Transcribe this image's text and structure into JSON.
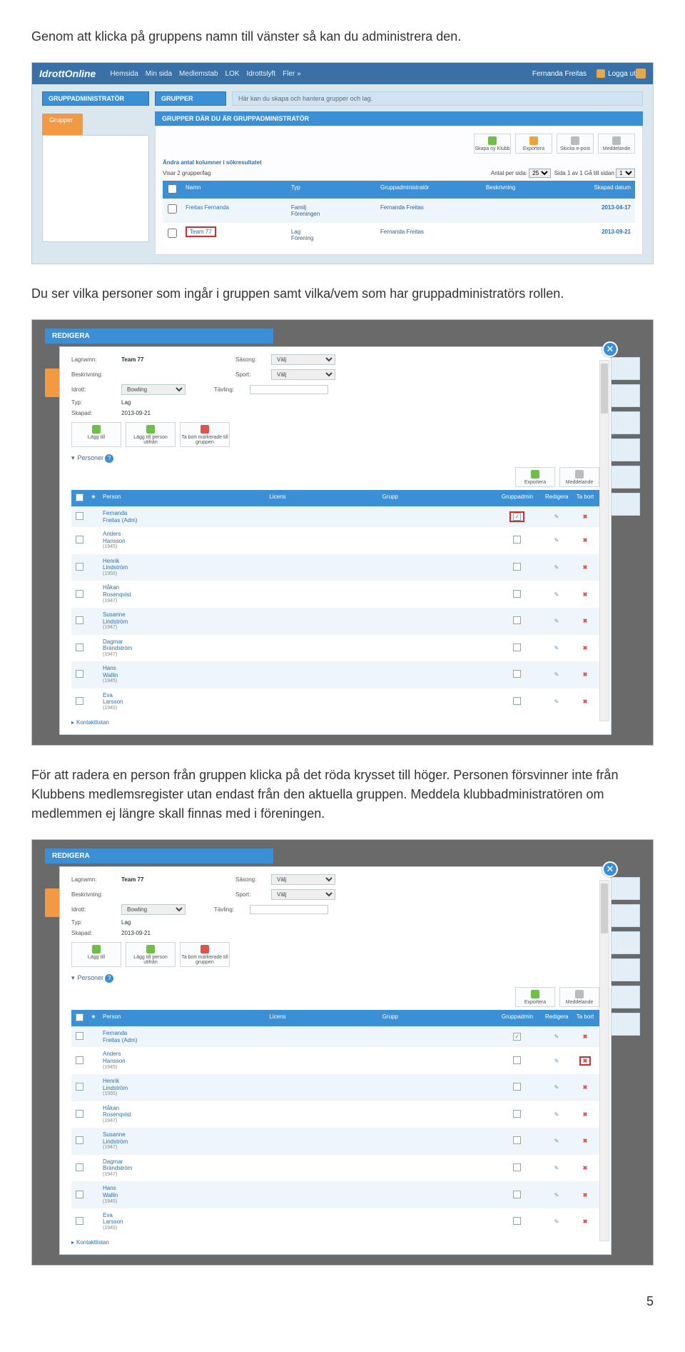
{
  "para1": "Genom att klicka på gruppens namn till vänster så kan du administrera den.",
  "para2": "Du ser vilka personer som ingår i gruppen samt vilka/vem som har gruppadministratörs rollen.",
  "para3a": "För att radera en person från gruppen klicka på det röda krysset till höger. ",
  "para3b": "Personen försvinner inte från Klubbens medlemsregister utan endast från den aktuella gruppen. Meddela klubbadministratören om medlemmen ej längre skall finnas med i föreningen.",
  "pageNumber": "5",
  "topbar": {
    "logo": "IdrottOnline",
    "nav": [
      "Hemsida",
      "Min sida",
      "Medlemstab",
      "LOK",
      "Idrottslyft",
      "Fler »"
    ],
    "user": "Fernanda Freitas",
    "logout": "Logga ut"
  },
  "shot1": {
    "leftHead": "GRUPPADMINISTRATÖR",
    "rightHead": "GRUPPER",
    "rightNote": "Här kan du skapa och hantera grupper och lag.",
    "leftTab": "Grupper",
    "subHead": "GRUPPER DÄR DU ÄR GRUPPADMINISTRATÖR",
    "toolbar": [
      {
        "label": "Skapa ny Klubb",
        "cls": "ico-g"
      },
      {
        "label": "Exportera",
        "cls": "ico-o"
      },
      {
        "label": "Skicka e-post",
        "cls": "ico-b"
      },
      {
        "label": "Meddelande",
        "cls": "ico-b"
      }
    ],
    "pg": {
      "left": "Ändra antal kolumner i sökresultatet",
      "vis": "Visar 2 grupper/lag",
      "mid": "Antal per sida:",
      "sel": "25",
      "right": "Sida 1 av 1 Gå till sidan",
      "sel2": "1"
    },
    "thead": [
      "",
      "Namn",
      "Typ",
      "Gruppadministratör",
      "Beskrivning",
      "Skapad datum"
    ],
    "rows": [
      {
        "chk": false,
        "name": "Freitas Fernanda",
        "typ": "Familj\nFöreningen",
        "admin": "Fernanda Freitas",
        "beskr": "",
        "date": "2013-04-17",
        "hi": false
      },
      {
        "chk": false,
        "name": "Team 77",
        "typ": "Lag\nFörening",
        "admin": "Fernanda Freitas",
        "beskr": "",
        "date": "2013-09-21",
        "hi": true
      }
    ]
  },
  "modal": {
    "title": "REDIGERA",
    "fields": {
      "lagnamn": {
        "label": "Lagnamn:",
        "val": "Team 77"
      },
      "saesong": {
        "label": "Säsong:",
        "placeholder": "Välj"
      },
      "beskr": {
        "label": "Beskrivning:"
      },
      "sport": {
        "label": "Sport:",
        "placeholder": "Välj"
      },
      "idrott": {
        "label": "Idrott:",
        "val": "Bowling"
      },
      "tavling": {
        "label": "Tävling:"
      },
      "typ": {
        "label": "Typ:",
        "val": "Lag"
      },
      "skapad": {
        "label": "Skapad:",
        "val": "2013-09-21"
      }
    },
    "mtoolbar": [
      {
        "label": "Lägg till",
        "cls": "ico-g"
      },
      {
        "label": "Lägg till person utifrån",
        "cls": "ico-g"
      },
      {
        "label": "Ta bort markerade till gruppen",
        "cls": "ico-r"
      }
    ],
    "subHead": "Personer",
    "rtoolbar": [
      {
        "label": "Exportera",
        "cls": "ico-g"
      },
      {
        "label": "Meddelande",
        "cls": "ico-b"
      }
    ],
    "thead": [
      "",
      "★",
      "Person",
      "Licens",
      "Grupp",
      "Gruppadmin",
      "Redigera",
      "Ta bort"
    ],
    "rows": [
      {
        "name": "Fernanda",
        "last": "Freitas (Adm)",
        "adm": true
      },
      {
        "name": "Anders",
        "last": "Hansson",
        "sub": "(1945)"
      },
      {
        "name": "Henrik",
        "last": "Lindström",
        "sub": "(1955)"
      },
      {
        "name": "Håkan",
        "last": "Rosenqvist",
        "sub": "(1947)"
      },
      {
        "name": "Susanne",
        "last": "Lindström",
        "sub": "(1947)"
      },
      {
        "name": "Dagmar",
        "last": "Brändström",
        "sub": "(1947)"
      },
      {
        "name": "Hans",
        "last": "Wallin",
        "sub": "(1945)"
      },
      {
        "name": "Eva",
        "last": "Larsson",
        "sub": "(1945)"
      }
    ],
    "foot": "Kontaktlistan"
  }
}
